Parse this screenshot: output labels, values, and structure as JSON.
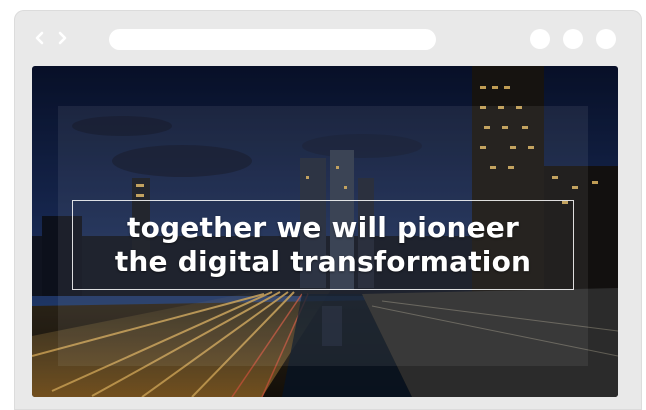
{
  "hero": {
    "line1": "together we will pioneer",
    "line2": "the digital transformation"
  },
  "icons": {
    "back": "chevron-left-icon",
    "forward": "chevron-right-icon"
  },
  "colors": {
    "chrome": "#e9e9e9",
    "sky_top": "#0a1535",
    "sky_bottom": "#2a4a8a",
    "light_trail": "#ffc060",
    "headline": "#ffffff"
  }
}
